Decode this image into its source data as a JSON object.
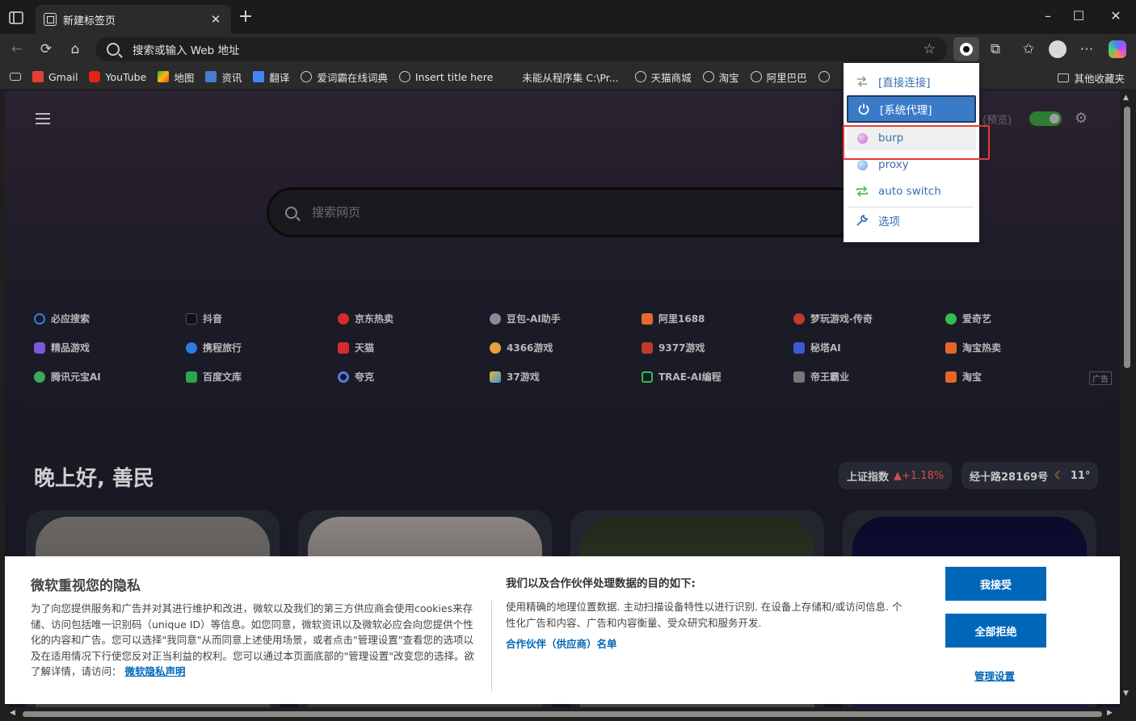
{
  "tab": {
    "title": "新建标签页"
  },
  "toolbar": {
    "address": "搜索或输入 Web 地址"
  },
  "bookmarks": {
    "items": [
      "Gmail",
      "YouTube",
      "地图",
      "资讯",
      "翻译",
      "爱词霸在线词典",
      "Insert title here",
      "未能从程序集 C:\\Pr...",
      "天猫商城",
      "淘宝",
      "阿里巴巴"
    ],
    "other": "其他收藏夹"
  },
  "page": {
    "preview_label": "(预览)",
    "search_placeholder": "搜索网页",
    "greeting": "晚上好, 善民",
    "stock": {
      "name": "上证指数",
      "change": "▲+1.18%"
    },
    "weather": {
      "location": "经十路28169号",
      "temp": "11°"
    },
    "ad_label": "广告",
    "quick_links": [
      [
        "必应搜索",
        "抖音",
        "京东热卖",
        "豆包-AI助手",
        "阿里1688",
        "梦玩游戏-传奇",
        "爱奇艺"
      ],
      [
        "精品游戏",
        "携程旅行",
        "天猫",
        "4366游戏",
        "9377游戏",
        "秘塔AI",
        "淘宝热卖"
      ],
      [
        "腾讯元宝AI",
        "百度文库",
        "夸克",
        "37游戏",
        "TRAE-AI编程",
        "帝王霸业",
        "淘宝"
      ]
    ]
  },
  "privacy": {
    "title": "微软重视您的隐私",
    "body": "为了向您提供服务和广告并对其进行维护和改进，微软以及我们的第三方供应商会使用cookies来存储、访问包括唯一识别码（unique ID）等信息。如您同意，微软资讯以及微软必应会向您提供个性化的内容和广告。您可以选择\"我同意\"从而同意上述使用场景，或者点击\"管理设置\"查看您的选项以及在适用情况下行使您反对正当利益的权利。您可以通过本页面底部的\"管理设置\"改变您的选择。欲了解详情，请访问：",
    "body_link": "微软隐私声明",
    "purposes_title": "我们以及合作伙伴处理数据的目的如下:",
    "purposes": "使用精确的地理位置数据. 主动扫描设备特性以进行识别. 在设备上存储和/或访问信息. 个性化广告和内容、广告和内容衡量、受众研究和服务开发.",
    "partners_link": "合作伙伴（供应商）名单",
    "accept": "我接受",
    "reject": "全部拒绝",
    "manage": "管理设置"
  },
  "proxy_menu": {
    "items": [
      "[直接连接]",
      "[系统代理]",
      "burp",
      "proxy",
      "auto switch",
      "选项"
    ],
    "selected": "[系统代理]",
    "highlighted": "burp"
  },
  "colors": {
    "accent": "#0067b8",
    "menu_selected": "#3a7bc8",
    "highlight_box": "#e53935",
    "toggle_on": "#2e7d32"
  }
}
